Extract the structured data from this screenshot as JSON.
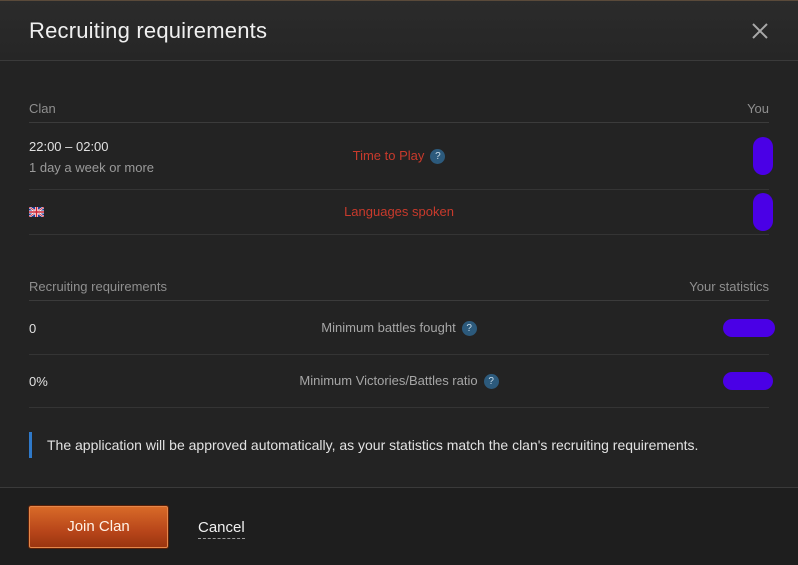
{
  "dialog": {
    "title": "Recruiting requirements"
  },
  "clan_section": {
    "left_header": "Clan",
    "right_header": "You",
    "time_row": {
      "time": "22:00 – 02:00",
      "frequency": "1 day a week or more",
      "label": "Time to Play"
    },
    "language_row": {
      "flag": "uk-flag-icon",
      "label": "Languages spoken"
    }
  },
  "requirements_section": {
    "left_header": "Recruiting requirements",
    "right_header": "Your statistics",
    "battles_row": {
      "value": "0",
      "label": "Minimum battles fought"
    },
    "ratio_row": {
      "value": "0%",
      "label": "Minimum Victories/Battles ratio"
    }
  },
  "notice": "The application will be approved automatically, as your statistics match the clan's recruiting requirements.",
  "footer": {
    "join_label": "Join Clan",
    "cancel_label": "Cancel"
  },
  "colors": {
    "accent_orange": "#c55520",
    "warning_red": "#c83a2c",
    "info_blue": "#2f79c9",
    "redaction": "#4a00e6"
  }
}
